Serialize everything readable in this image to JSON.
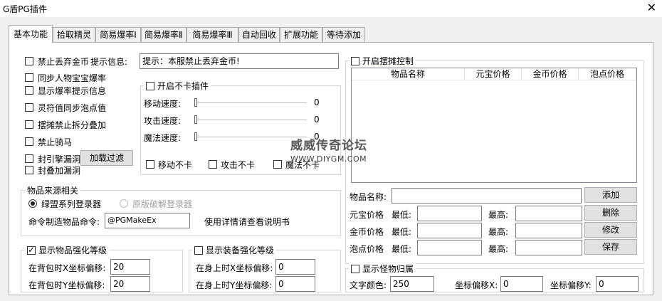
{
  "window": {
    "title": "G盾PG插件",
    "close_glyph": "✕"
  },
  "tabs": [
    "基本功能",
    "拾取精灵",
    "简易爆率Ⅰ",
    "简易爆率Ⅱ",
    "简易爆率Ⅲ",
    "自动回收",
    "扩展功能",
    "等待添加"
  ],
  "basic": {
    "forbid_drop_gold": "禁止丢弃金币",
    "tip_label": "提示信息:",
    "tip_value": "提示：本服禁止丢弃金币!",
    "sync_person_item_rate": "同步人物宝宝爆率",
    "show_rate_tip": "显示爆率提示信息",
    "spirit_sync_bubble": "灵符值同步泡点值",
    "stall_forbid_split": "摆摊禁止拆分叠加",
    "forbid_ride": "禁止骑马",
    "seal_engine_bug": "封引擎漏洞",
    "load_filter_button": "加载过滤",
    "seal_stack_bug": "封叠加漏洞"
  },
  "nolag": {
    "title": "开启不卡插件",
    "move_speed_label": "移动速度:",
    "move_speed_value": "0",
    "attack_speed_label": "攻击速度:",
    "attack_speed_value": "0",
    "magic_speed_label": "魔法速度:",
    "magic_speed_value": "0",
    "move_nolag": "移动不卡",
    "attack_nolag": "攻击不卡",
    "magic_nolag": "魔法不卡"
  },
  "item_source": {
    "title": "物品来源相关",
    "radio_mengmeng": "绿盟系列登录器",
    "radio_original": "原版破解登录器",
    "command_label": "命令制造物品命令:",
    "command_value": "@PGMakeEx",
    "hint": "使用详情请查看说明书"
  },
  "item_enhance": {
    "title": "显示物品强化等级",
    "checked": true,
    "x_label": "在背包时X坐标偏移:",
    "x_value": "20",
    "y_label": "在背包时Y坐标偏移:",
    "y_value": "20"
  },
  "equip_enhance": {
    "title": "显示装备强化等级",
    "checked": false,
    "x_label": "在身上时X坐标偏移:",
    "x_value": "0",
    "y_label": "在身上时Y坐标偏移:",
    "y_value": "0"
  },
  "stall": {
    "title": "开启摆摊控制",
    "columns": [
      "物品名称",
      "元宝价格",
      "金币价格",
      "泡点价格"
    ],
    "name_label": "物品名称:",
    "name_value": "",
    "yuanbao_label": "元宝价格",
    "gold_label": "金币价格",
    "bubble_label": "泡点价格",
    "min_label": "最低:",
    "max_label": "最高:",
    "add_button": "添加",
    "delete_button": "删除",
    "modify_button": "修改",
    "save_button": "保存"
  },
  "monster": {
    "title": "显示怪物归属",
    "text_color_label": "文字颜色:",
    "text_color_value": "250",
    "x_label": "坐标偏移X:",
    "x_value": "0",
    "y_label": "坐标偏移Y:",
    "y_value": "0"
  },
  "watermark": {
    "line1": "威威传奇论坛",
    "line2": "WWW.DIYGM.COM"
  }
}
